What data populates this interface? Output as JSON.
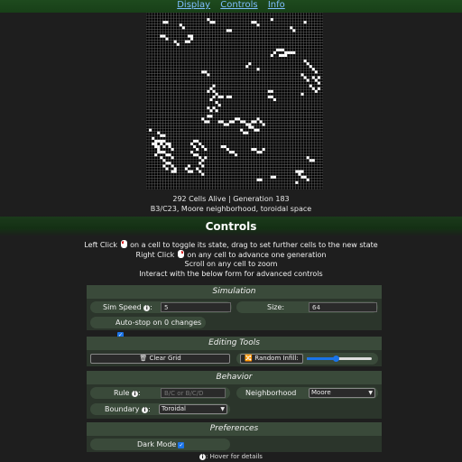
{
  "nav": {
    "display": "Display",
    "controls": "Controls",
    "info": "Info"
  },
  "status": {
    "line1": "292 Cells Alive | Generation 183",
    "line2": "B3/C23, Moore neighborhood, toroidal space"
  },
  "controls": {
    "title": "Controls",
    "instructions": {
      "left_pre": "Left Click",
      "left_post": "on a cell to toggle its state, drag to set further cells to the new state",
      "right_pre": "Right Click",
      "right_post": "on any cell to advance one generation",
      "scroll": "Scroll on any cell to zoom",
      "form": "Interact with the below form for advanced controls"
    }
  },
  "simulation": {
    "title": "Simulation",
    "sim_speed_label": "Sim Speed",
    "sim_speed_value": "5",
    "size_label": "Size:",
    "size_value": "64",
    "autostop_label": "Auto-stop on 0 changes",
    "autostop_checked": true
  },
  "editing": {
    "title": "Editing Tools",
    "clear_label": "🗑 Clear Grid",
    "random_label": "🔀 Random Infill:",
    "random_level": 0.45
  },
  "behavior": {
    "title": "Behavior",
    "rule_label": "Rule",
    "rule_placeholder": "B/C or B/C/D",
    "neighborhood_label": "Neighborhood",
    "neighborhood_value": "Moore",
    "boundary_label": "Boundary",
    "boundary_value": "Toroidal"
  },
  "preferences": {
    "title": "Preferences",
    "dark_mode_label": "Dark Mode",
    "dark_mode_checked": true
  },
  "footnote": ": Hover for details",
  "info_glyph": "i",
  "colors": {
    "cell_alive": "#ffffff",
    "grid_line": "#6a6a6a",
    "background": "#1e1e1e",
    "accent": "#1a73e8"
  },
  "grid": {
    "cols": 64,
    "rows": 64,
    "alive_cells": [
      [
        6,
        3
      ],
      [
        7,
        3
      ],
      [
        12,
        4
      ],
      [
        13,
        5
      ],
      [
        5,
        8
      ],
      [
        6,
        8
      ],
      [
        7,
        9
      ],
      [
        15,
        8
      ],
      [
        16,
        8
      ],
      [
        16,
        9
      ],
      [
        14,
        10
      ],
      [
        15,
        10
      ],
      [
        10,
        10
      ],
      [
        11,
        11
      ],
      [
        22,
        2
      ],
      [
        23,
        3
      ],
      [
        24,
        3
      ],
      [
        29,
        6
      ],
      [
        30,
        6
      ],
      [
        38,
        3
      ],
      [
        39,
        3
      ],
      [
        40,
        4
      ],
      [
        45,
        2
      ],
      [
        52,
        5
      ],
      [
        53,
        6
      ],
      [
        57,
        3
      ],
      [
        47,
        13
      ],
      [
        48,
        13
      ],
      [
        49,
        13
      ],
      [
        50,
        14
      ],
      [
        51,
        14
      ],
      [
        46,
        14
      ],
      [
        45,
        15
      ],
      [
        48,
        15
      ],
      [
        49,
        15
      ],
      [
        50,
        15
      ],
      [
        52,
        14
      ],
      [
        53,
        14
      ],
      [
        20,
        21
      ],
      [
        21,
        21
      ],
      [
        22,
        22
      ],
      [
        40,
        20
      ],
      [
        37,
        18
      ],
      [
        36,
        19
      ],
      [
        57,
        17
      ],
      [
        58,
        18
      ],
      [
        59,
        19
      ],
      [
        60,
        20
      ],
      [
        61,
        21
      ],
      [
        60,
        23
      ],
      [
        61,
        24
      ],
      [
        62,
        25
      ],
      [
        56,
        22
      ],
      [
        57,
        23
      ],
      [
        58,
        24
      ],
      [
        59,
        26
      ],
      [
        60,
        27
      ],
      [
        61,
        28
      ],
      [
        62,
        23
      ],
      [
        62,
        27
      ],
      [
        56,
        29
      ],
      [
        24,
        26
      ],
      [
        23,
        27
      ],
      [
        22,
        28
      ],
      [
        24,
        28
      ],
      [
        25,
        29
      ],
      [
        26,
        30
      ],
      [
        27,
        30
      ],
      [
        24,
        30
      ],
      [
        23,
        31
      ],
      [
        25,
        32
      ],
      [
        26,
        33
      ],
      [
        24,
        34
      ],
      [
        25,
        35
      ],
      [
        22,
        34
      ],
      [
        23,
        35
      ],
      [
        29,
        30
      ],
      [
        30,
        30
      ],
      [
        44,
        28
      ],
      [
        45,
        28
      ],
      [
        44,
        30
      ],
      [
        45,
        30
      ],
      [
        46,
        31
      ],
      [
        22,
        37
      ],
      [
        23,
        37
      ],
      [
        20,
        38
      ],
      [
        21,
        39
      ],
      [
        22,
        39
      ],
      [
        26,
        39
      ],
      [
        27,
        39
      ],
      [
        28,
        40
      ],
      [
        29,
        40
      ],
      [
        30,
        39
      ],
      [
        31,
        39
      ],
      [
        32,
        38
      ],
      [
        33,
        38
      ],
      [
        34,
        39
      ],
      [
        35,
        39
      ],
      [
        36,
        40
      ],
      [
        37,
        40
      ],
      [
        38,
        39
      ],
      [
        39,
        39
      ],
      [
        40,
        38
      ],
      [
        41,
        39
      ],
      [
        42,
        40
      ],
      [
        37,
        41
      ],
      [
        38,
        41
      ],
      [
        39,
        42
      ],
      [
        40,
        42
      ],
      [
        36,
        43
      ],
      [
        35,
        43
      ],
      [
        34,
        42
      ],
      [
        1,
        42
      ],
      [
        4,
        43
      ],
      [
        5,
        44
      ],
      [
        6,
        44
      ],
      [
        2,
        45
      ],
      [
        3,
        46
      ],
      [
        4,
        46
      ],
      [
        5,
        46
      ],
      [
        6,
        46
      ],
      [
        2,
        47
      ],
      [
        3,
        47
      ],
      [
        5,
        47
      ],
      [
        7,
        47
      ],
      [
        8,
        47
      ],
      [
        3,
        48
      ],
      [
        4,
        48
      ],
      [
        6,
        48
      ],
      [
        8,
        48
      ],
      [
        9,
        49
      ],
      [
        4,
        49
      ],
      [
        5,
        50
      ],
      [
        6,
        50
      ],
      [
        7,
        51
      ],
      [
        8,
        51
      ],
      [
        9,
        52
      ],
      [
        5,
        52
      ],
      [
        6,
        53
      ],
      [
        7,
        54
      ],
      [
        8,
        54
      ],
      [
        9,
        55
      ],
      [
        10,
        56
      ],
      [
        9,
        57
      ],
      [
        10,
        57
      ],
      [
        6,
        55
      ],
      [
        7,
        56
      ],
      [
        4,
        50
      ],
      [
        3,
        51
      ],
      [
        17,
        46
      ],
      [
        18,
        46
      ],
      [
        16,
        47
      ],
      [
        19,
        47
      ],
      [
        20,
        48
      ],
      [
        17,
        48
      ],
      [
        18,
        49
      ],
      [
        21,
        49
      ],
      [
        16,
        50
      ],
      [
        17,
        51
      ],
      [
        18,
        51
      ],
      [
        19,
        52
      ],
      [
        21,
        52
      ],
      [
        20,
        53
      ],
      [
        19,
        54
      ],
      [
        20,
        55
      ],
      [
        15,
        55
      ],
      [
        14,
        56
      ],
      [
        15,
        57
      ],
      [
        16,
        57
      ],
      [
        18,
        56
      ],
      [
        19,
        57
      ],
      [
        20,
        58
      ],
      [
        27,
        48
      ],
      [
        28,
        48
      ],
      [
        29,
        49
      ],
      [
        30,
        50
      ],
      [
        31,
        50
      ],
      [
        32,
        51
      ],
      [
        38,
        49
      ],
      [
        39,
        49
      ],
      [
        40,
        50
      ],
      [
        41,
        50
      ],
      [
        42,
        49
      ],
      [
        58,
        52
      ],
      [
        59,
        53
      ],
      [
        60,
        53
      ],
      [
        54,
        57
      ],
      [
        55,
        57
      ],
      [
        56,
        57
      ],
      [
        55,
        58
      ],
      [
        56,
        59
      ],
      [
        57,
        59
      ],
      [
        58,
        60
      ],
      [
        54,
        61
      ],
      [
        40,
        60
      ],
      [
        41,
        60
      ],
      [
        45,
        59
      ],
      [
        46,
        59
      ]
    ]
  }
}
